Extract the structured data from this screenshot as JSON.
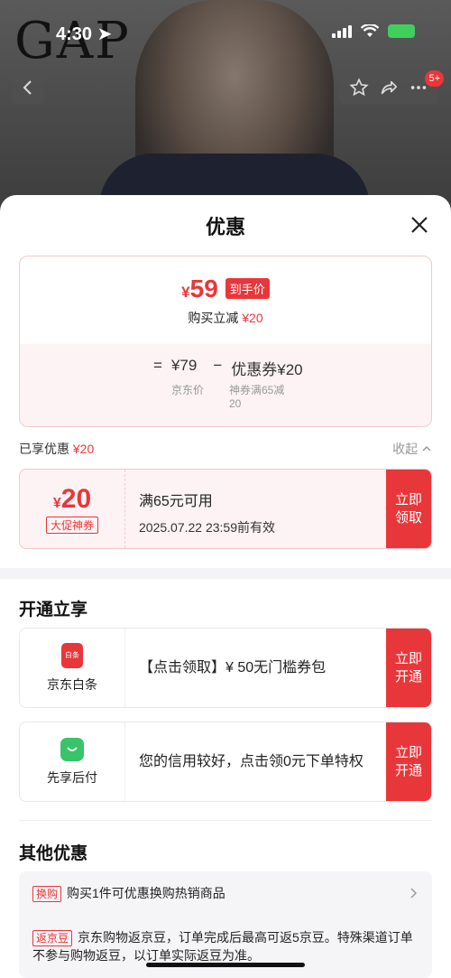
{
  "status_bar": {
    "time": "4:30"
  },
  "brand": {
    "logo_text": "GAP"
  },
  "header_nav": {
    "badge_count": "5+"
  },
  "sheet": {
    "title": "优惠",
    "price_card": {
      "currency": "¥",
      "final_price": "59",
      "final_tag": "到手价",
      "save_prefix": "购买立减",
      "save_amount": "¥20",
      "equals": "=",
      "base_price": "¥79",
      "minus": "−",
      "coupon_item": "优惠券¥20",
      "base_label": "京东价",
      "coupon_label_line1": "神券满65减",
      "coupon_label_line2": "20"
    },
    "enjoyed": {
      "label": "已享优惠",
      "amount": "¥20",
      "collapse_label": "收起"
    },
    "coupon": {
      "currency": "¥",
      "value": "20",
      "tag": "大促神券",
      "condition": "满65元可用",
      "expiry": "2025.07.22 23:59前有效",
      "button_line1": "立即",
      "button_line2": "领取"
    },
    "open_section": {
      "title": "开通立享",
      "items": [
        {
          "icon": "jd-baitiao-icon",
          "icon_text": "白条",
          "name": "京东白条",
          "text": "【点击领取】¥ 50无门槛券包",
          "button_line1": "立即",
          "button_line2": "开通"
        },
        {
          "icon": "bag-smile-icon",
          "name": "先享后付",
          "text": "您的信用较好，点击领0元下单特权",
          "button_line1": "立即",
          "button_line2": "开通"
        }
      ]
    },
    "other_section": {
      "title": "其他优惠",
      "rows": [
        {
          "tag": "换购",
          "text": "购买1件可优惠换购热销商品"
        },
        {
          "tag": "返京豆",
          "text": "京东购物返京豆，订单完成后最高可返5京豆。特殊渠道订单不参与购物返豆，以订单实际返豆为准。"
        }
      ]
    }
  },
  "colors": {
    "accent": "#e8373a",
    "accent_soft": "#fdf3f4",
    "baitiao": "#e8373a",
    "xianxiang": "#37c46a"
  }
}
